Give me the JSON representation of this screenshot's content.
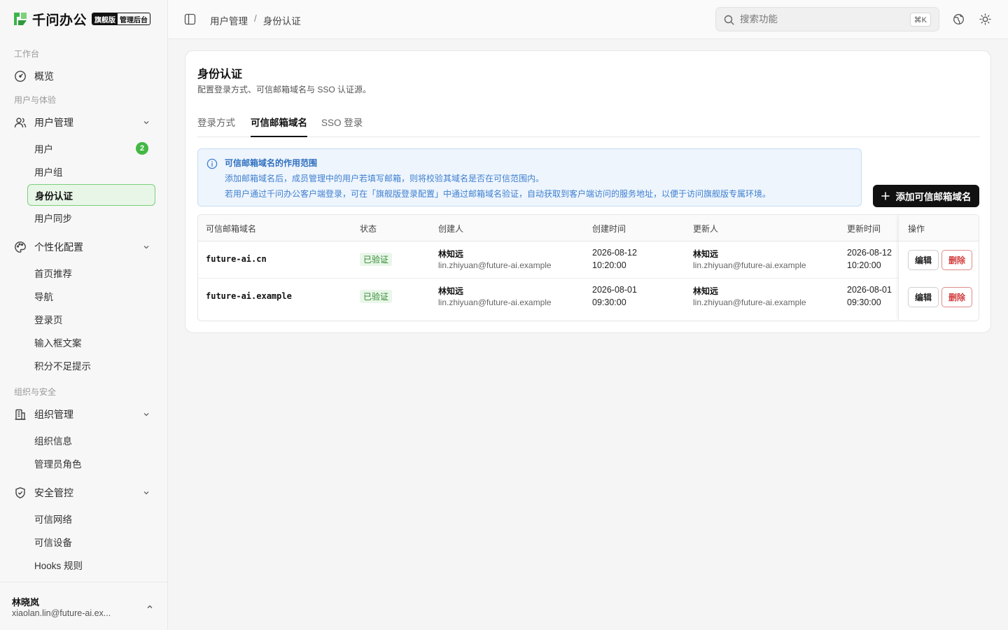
{
  "brand": {
    "name": "千问办公",
    "badge_edition": "旗舰版",
    "badge_console": "管理后台",
    "accent_color": "#43b843"
  },
  "sidebar": {
    "sections": [
      {
        "label": "工作台"
      },
      {
        "label": "用户与体验"
      },
      {
        "label": "组织与安全"
      }
    ],
    "overview": {
      "label": "概览",
      "icon": "gauge-icon"
    },
    "user_mgmt": {
      "label": "用户管理",
      "icon": "users-icon",
      "expanded": true,
      "items": [
        {
          "label": "用户",
          "count": "2"
        },
        {
          "label": "用户组"
        },
        {
          "label": "身份认证",
          "active": true
        },
        {
          "label": "用户同步"
        }
      ]
    },
    "personalize": {
      "label": "个性化配置",
      "icon": "palette-icon",
      "expanded": true,
      "items": [
        {
          "label": "首页推荐"
        },
        {
          "label": "导航"
        },
        {
          "label": "登录页"
        },
        {
          "label": "输入框文案"
        },
        {
          "label": "积分不足提示"
        }
      ]
    },
    "org_mgmt": {
      "label": "组织管理",
      "icon": "building-icon",
      "expanded": true,
      "items": [
        {
          "label": "组织信息"
        },
        {
          "label": "管理员角色"
        }
      ]
    },
    "security": {
      "label": "安全管控",
      "icon": "shield-icon",
      "expanded": true,
      "items": [
        {
          "label": "可信网络"
        },
        {
          "label": "可信设备"
        },
        {
          "label": "Hooks 规则"
        }
      ]
    },
    "user": {
      "name": "林晓岚",
      "email": "xiaolan.lin@future-ai.ex..."
    }
  },
  "header": {
    "breadcrumb": [
      "用户管理",
      "/",
      "身份认证"
    ],
    "search": {
      "placeholder": "搜索功能",
      "shortcut": "⌘K"
    }
  },
  "main": {
    "title": "身份认证",
    "description": "配置登录方式、可信邮箱域名与 SSO 认证源。",
    "tabs": [
      {
        "label": "登录方式"
      },
      {
        "label": "可信邮箱域名",
        "active": true
      },
      {
        "label": "SSO 登录"
      }
    ],
    "notice": {
      "title": "可信邮箱域名的作用范围",
      "lines": [
        "添加邮箱域名后，成员管理中的用户若填写邮箱，则将校验其域名是否在可信范围内。",
        "若用户通过千问办公客户端登录，可在「旗舰版登录配置」中通过邮箱域名验证，自动获取到客户端访问的服务地址，以便于访问旗舰版专属环境。"
      ],
      "color": "#3f7fcf"
    },
    "add_button": "添加可信邮箱域名",
    "table": {
      "columns": [
        "可信邮箱域名",
        "状态",
        "创建人",
        "创建时间",
        "更新人",
        "更新时间",
        "操作"
      ],
      "rows": [
        {
          "domain": "future-ai.cn",
          "status": "已验证",
          "creator_name": "林知远",
          "creator_email": "lin.zhiyuan@future-ai.example",
          "created_date": "2026-08-12",
          "created_time": "10:20:00",
          "updater_name": "林知远",
          "updater_email": "lin.zhiyuan@future-ai.example",
          "updated_date": "2026-08-12",
          "updated_time": "10:20:00",
          "edit": "编辑",
          "delete": "删除"
        },
        {
          "domain": "future-ai.example",
          "status": "已验证",
          "creator_name": "林知远",
          "creator_email": "lin.zhiyuan@future-ai.example",
          "created_date": "2026-08-01",
          "created_time": "09:30:00",
          "updater_name": "林知远",
          "updater_email": "lin.zhiyuan@future-ai.example",
          "updated_date": "2026-08-01",
          "updated_time": "09:30:00",
          "edit": "编辑",
          "delete": "删除"
        }
      ]
    }
  }
}
